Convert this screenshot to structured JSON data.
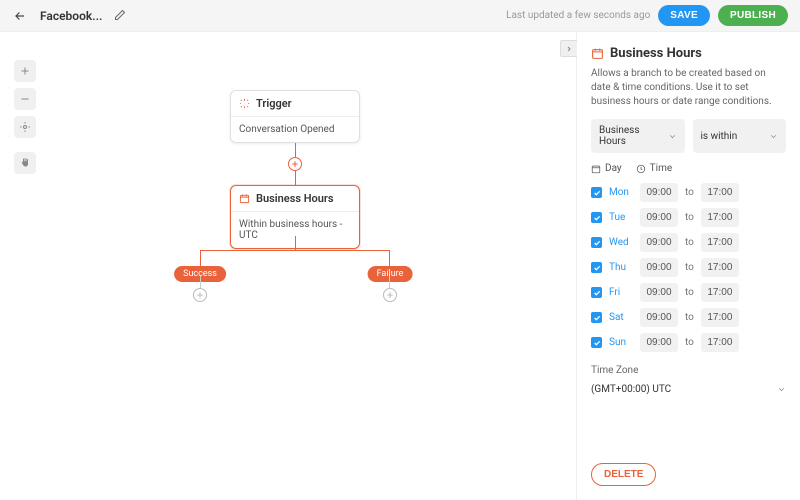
{
  "header": {
    "title": "Facebook...",
    "last_updated": "Last updated a few seconds ago",
    "save": "SAVE",
    "publish": "PUBLISH"
  },
  "canvas": {
    "nodes": {
      "trigger": {
        "title": "Trigger",
        "body": "Conversation Opened"
      },
      "business_hours": {
        "title": "Business Hours",
        "body": "Within business hours - UTC"
      }
    },
    "branches": {
      "success": "Success",
      "failure": "Failure"
    }
  },
  "sidebar": {
    "title": "Business Hours",
    "description": "Allows a branch to be created based on date & time conditions. Use it to set business hours or date range conditions.",
    "select_type": "Business Hours",
    "select_condition": "is within",
    "mode_day": "Day",
    "mode_time": "Time",
    "days": [
      {
        "label": "Mon",
        "from": "09:00",
        "to": "17:00"
      },
      {
        "label": "Tue",
        "from": "09:00",
        "to": "17:00"
      },
      {
        "label": "Wed",
        "from": "09:00",
        "to": "17:00"
      },
      {
        "label": "Thu",
        "from": "09:00",
        "to": "17:00"
      },
      {
        "label": "Fri",
        "from": "09:00",
        "to": "17:00"
      },
      {
        "label": "Sat",
        "from": "09:00",
        "to": "17:00"
      },
      {
        "label": "Sun",
        "from": "09:00",
        "to": "17:00"
      }
    ],
    "to_label": "to",
    "tz_label": "Time Zone",
    "tz_value": "(GMT+00:00) UTC",
    "delete": "DELETE"
  }
}
